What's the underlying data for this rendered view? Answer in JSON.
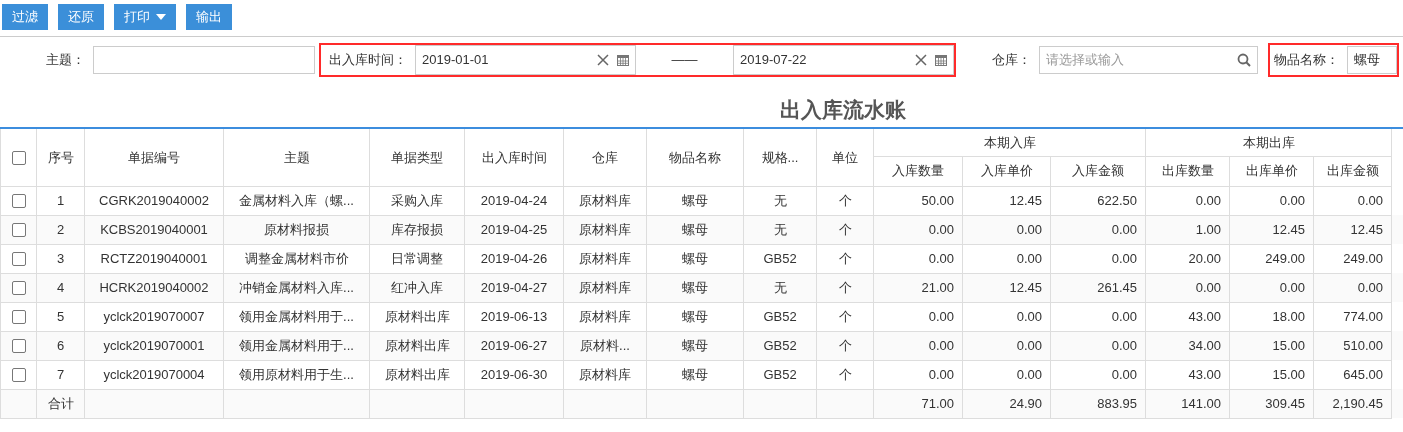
{
  "toolbar": [
    {
      "label": "过滤",
      "kind": "button"
    },
    {
      "label": "还原",
      "kind": "button"
    },
    {
      "label": "打印",
      "kind": "dropdown"
    },
    {
      "label": "输出",
      "kind": "button"
    }
  ],
  "filters": [
    {
      "kind": "text",
      "label": "主题：",
      "highlighted": false
    },
    {
      "kind": "range",
      "label": "出入库时间：",
      "from": "2019-01-01",
      "to": "2019-07-22",
      "separator": "——",
      "highlighted": true
    },
    {
      "kind": "search",
      "label": "仓库：",
      "placeholder": "请选择或输入",
      "highlighted": false
    },
    {
      "kind": "text",
      "label": "物品名称：",
      "value": "螺母",
      "highlighted": true
    }
  ],
  "report_title": "出入库流水账",
  "table": {
    "columns": [
      {
        "kind": "checkbox",
        "checked": false
      },
      {
        "label": "序号"
      },
      {
        "label": "单据编号"
      },
      {
        "label": "主题"
      },
      {
        "label": "单据类型"
      },
      {
        "label": "出入库时间"
      },
      {
        "label": "仓库"
      },
      {
        "label": "物品名称"
      },
      {
        "label": "规格..."
      },
      {
        "label": "单位"
      },
      {
        "label": "本期入库",
        "colspan": 3,
        "children": [
          {
            "label": "入库数量"
          },
          {
            "label": "入库单价"
          },
          {
            "label": "入库金额"
          }
        ]
      },
      {
        "label": "本期出库",
        "colspan": 3,
        "children": [
          {
            "label": "出库数量"
          },
          {
            "label": "出库单价"
          },
          {
            "label": "出库金额"
          }
        ]
      }
    ],
    "rows": [
      {
        "cells": [
          {
            "checked": false
          },
          "1",
          "CGRK2019040002",
          "金属材料入库（螺...",
          "采购入库",
          "2019-04-24",
          "原材料库",
          "螺母",
          "无",
          "个",
          "50.00",
          "12.45",
          "622.50",
          "0.00",
          "0.00",
          "0.00"
        ]
      },
      {
        "cells": [
          {
            "checked": false
          },
          "2",
          "KCBS2019040001",
          "原材料报损",
          "库存报损",
          "2019-04-25",
          "原材料库",
          "螺母",
          "无",
          "个",
          "0.00",
          "0.00",
          "0.00",
          "1.00",
          "12.45",
          "12.45"
        ]
      },
      {
        "cells": [
          {
            "checked": false
          },
          "3",
          "RCTZ2019040001",
          "调整金属材料市价",
          "日常调整",
          "2019-04-26",
          "原材料库",
          "螺母",
          "GB52",
          "个",
          "0.00",
          "0.00",
          "0.00",
          "20.00",
          "249.00",
          "249.00"
        ]
      },
      {
        "cells": [
          {
            "checked": false
          },
          "4",
          "HCRK2019040002",
          "冲销金属材料入库...",
          "红冲入库",
          "2019-04-27",
          "原材料库",
          "螺母",
          "无",
          "个",
          "21.00",
          "12.45",
          "261.45",
          "0.00",
          "0.00",
          "0.00"
        ]
      },
      {
        "cells": [
          {
            "checked": false
          },
          "5",
          "yclck2019070007",
          "领用金属材料用于...",
          "原材料出库",
          "2019-06-13",
          "原材料库",
          "螺母",
          "GB52",
          "个",
          "0.00",
          "0.00",
          "0.00",
          "43.00",
          "18.00",
          "774.00"
        ]
      },
      {
        "cells": [
          {
            "checked": false
          },
          "6",
          "yclck2019070001",
          "领用金属材料用于...",
          "原材料出库",
          "2019-06-27",
          "原材料...",
          "螺母",
          "GB52",
          "个",
          "0.00",
          "0.00",
          "0.00",
          "34.00",
          "15.00",
          "510.00"
        ]
      },
      {
        "cells": [
          {
            "checked": false
          },
          "7",
          "yclck2019070004",
          "领用原材料用于生...",
          "原材料出库",
          "2019-06-30",
          "原材料库",
          "螺母",
          "GB52",
          "个",
          "0.00",
          "0.00",
          "0.00",
          "43.00",
          "15.00",
          "645.00"
        ]
      },
      {
        "cells": [
          "",
          "合计",
          "",
          "",
          "",
          "",
          "",
          "",
          "",
          "",
          "71.00",
          "24.90",
          "883.95",
          "141.00",
          "309.45",
          "2,190.45"
        ]
      }
    ]
  }
}
